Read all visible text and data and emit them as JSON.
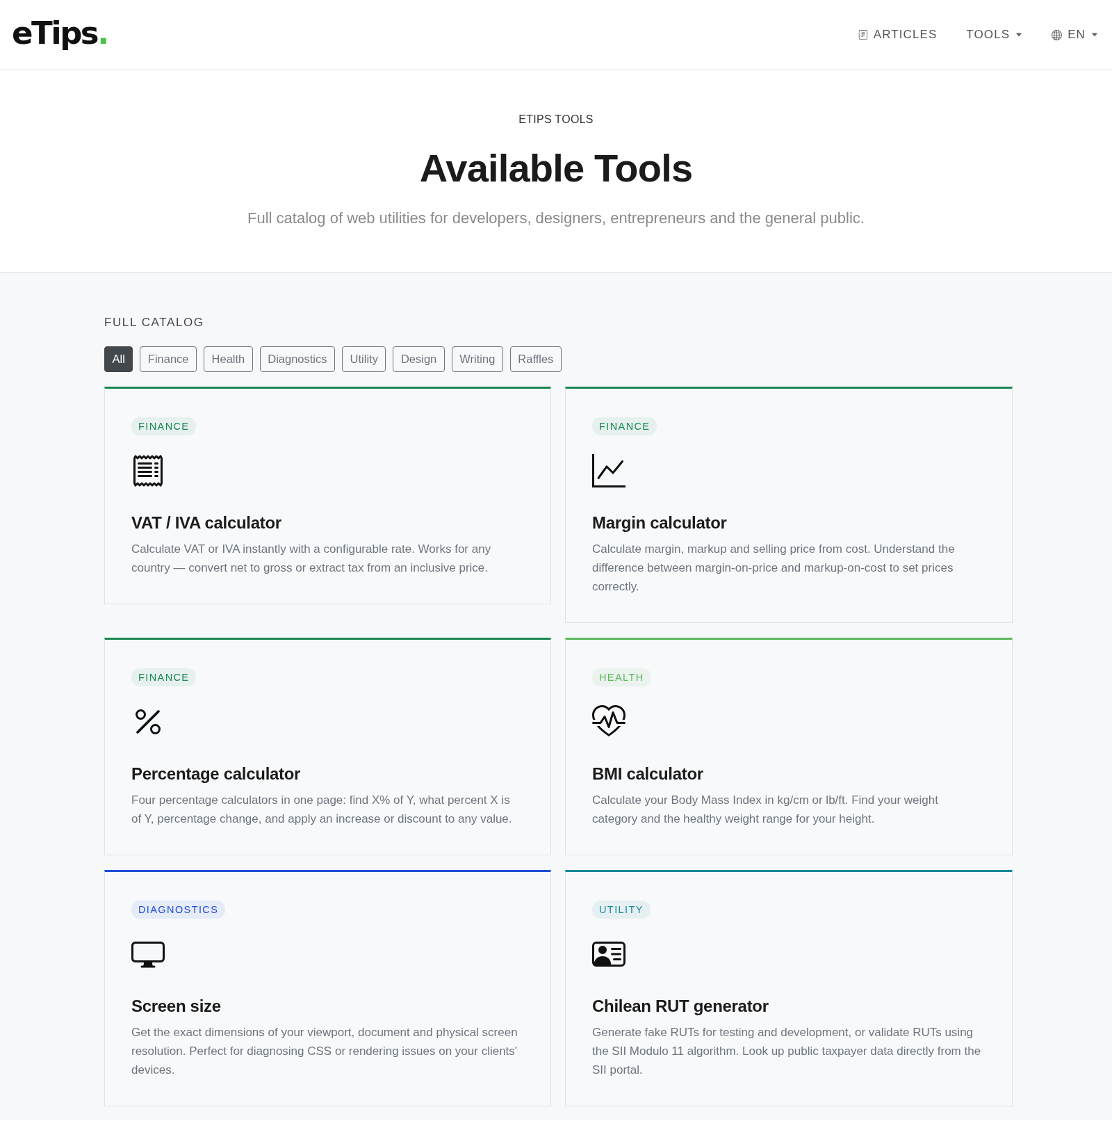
{
  "header": {
    "logo": {
      "text": "eTips",
      "accent": "."
    },
    "nav": [
      {
        "label": "ARTICLES",
        "kind": "link"
      },
      {
        "label": "TOOLS",
        "kind": "menu"
      },
      {
        "label": "EN",
        "kind": "language"
      }
    ]
  },
  "hero": {
    "eyebrow": "ETIPS TOOLS",
    "title": "Available Tools",
    "subtitle": "Full catalog of web utilities for developers, designers, entrepreneurs and the general public."
  },
  "catalog": {
    "heading": "FULL CATALOG",
    "filters": [
      {
        "label": "All",
        "selected": true
      },
      {
        "label": "Finance",
        "selected": false
      },
      {
        "label": "Health",
        "selected": false
      },
      {
        "label": "Diagnostics",
        "selected": false
      },
      {
        "label": "Utility",
        "selected": false
      },
      {
        "label": "Design",
        "selected": false
      },
      {
        "label": "Writing",
        "selected": false
      },
      {
        "label": "Raffles",
        "selected": false
      }
    ],
    "tools": [
      {
        "category": "FINANCE",
        "color": "#198754",
        "kind": "receipt",
        "title": "VAT / IVA calculator",
        "description": "Calculate VAT or IVA instantly with a configurable rate. Works for any country — convert net to gross or extract tax from an inclusive price."
      },
      {
        "category": "FINANCE",
        "color": "#198754",
        "kind": "chart",
        "title": "Margin calculator",
        "description": "Calculate margin, markup and selling price from cost. Understand the difference between margin-on-price and markup-on-cost to set prices correctly."
      },
      {
        "category": "FINANCE",
        "color": "#198754",
        "kind": "percent",
        "title": "Percentage calculator",
        "description": "Four percentage calculators in one page: find X% of Y, what percent X is of Y, percentage change, and apply an increase or discount to any value."
      },
      {
        "category": "HEALTH",
        "color": "#5cb85c",
        "kind": "heart",
        "title": "BMI calculator",
        "description": "Calculate your Body Mass Index in kg/cm or lb/ft. Find your weight category and the healthy weight range for your height."
      },
      {
        "category": "DIAGNOSTICS",
        "color": "#1f4fd8",
        "kind": "monitor",
        "title": "Screen size",
        "description": "Get the exact dimensions of your viewport, document and physical screen resolution. Perfect for diagnosing CSS or rendering issues on your clients' devices."
      },
      {
        "category": "UTILITY",
        "color": "#17889a",
        "kind": "idcard",
        "title": "Chilean RUT generator",
        "description": "Generate fake RUTs for testing and development, or validate RUTs using the SII Modulo 11 algorithm. Look up public taxpayer data directly from the SII portal."
      }
    ]
  }
}
